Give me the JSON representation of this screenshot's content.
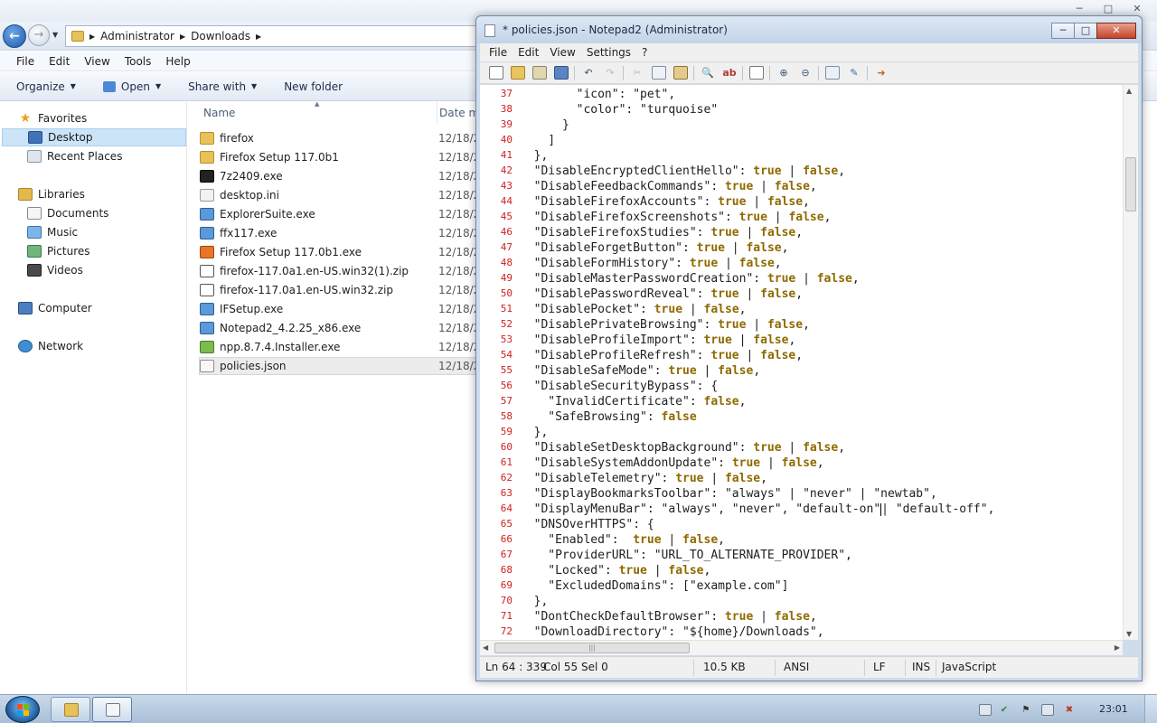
{
  "explorer": {
    "breadcrumb": [
      "Administrator",
      "Downloads"
    ],
    "menu": [
      "File",
      "Edit",
      "View",
      "Tools",
      "Help"
    ],
    "toolbar": {
      "organize": "Organize",
      "open": "Open",
      "share": "Share with",
      "new_folder": "New folder"
    },
    "nav": {
      "favorites": "Favorites",
      "desktop": "Desktop",
      "recent": "Recent Places",
      "libraries": "Libraries",
      "documents": "Documents",
      "music": "Music",
      "pictures": "Pictures",
      "videos": "Videos",
      "computer": "Computer",
      "network": "Network"
    },
    "columns": {
      "name": "Name",
      "date": "Date m"
    },
    "files": [
      {
        "name": "firefox",
        "date": "12/18/2",
        "icon": "folder-icon"
      },
      {
        "name": "Firefox Setup 117.0b1",
        "date": "12/18/2",
        "icon": "folder-icon"
      },
      {
        "name": "7z2409.exe",
        "date": "12/18/2",
        "icon": "7zip-icon"
      },
      {
        "name": "desktop.ini",
        "date": "12/18/2",
        "icon": "settings-file-icon"
      },
      {
        "name": "ExplorerSuite.exe",
        "date": "12/18/2",
        "icon": "application-icon"
      },
      {
        "name": "ffx117.exe",
        "date": "12/18/2",
        "icon": "application-icon"
      },
      {
        "name": "Firefox Setup 117.0b1.exe",
        "date": "12/18/2",
        "icon": "firefox-icon"
      },
      {
        "name": "firefox-117.0a1.en-US.win32(1).zip",
        "date": "12/18/2",
        "icon": "zip-icon"
      },
      {
        "name": "firefox-117.0a1.en-US.win32.zip",
        "date": "12/18/2",
        "icon": "zip-icon"
      },
      {
        "name": "IFSetup.exe",
        "date": "12/18/2",
        "icon": "application-icon"
      },
      {
        "name": "Notepad2_4.2.25_x86.exe",
        "date": "12/18/2",
        "icon": "notepad-icon"
      },
      {
        "name": "npp.8.7.4.Installer.exe",
        "date": "12/18/2",
        "icon": "notepadpp-icon"
      },
      {
        "name": "policies.json",
        "date": "12/18/2",
        "icon": "json-file-icon"
      }
    ]
  },
  "notepad": {
    "title": "* policies.json - Notepad2 (Administrator)",
    "menu": [
      "File",
      "Edit",
      "View",
      "Settings",
      "?"
    ],
    "lines": [
      {
        "n": "37",
        "t": "        \"icon\": \"pet\","
      },
      {
        "n": "38",
        "t": "        \"color\": \"turquoise\""
      },
      {
        "n": "39",
        "t": "      }"
      },
      {
        "n": "40",
        "t": "    ]"
      },
      {
        "n": "41",
        "t": "  },"
      },
      {
        "n": "42",
        "t": "  \"DisableEncryptedClientHello\": true | false,"
      },
      {
        "n": "43",
        "t": "  \"DisableFeedbackCommands\": true | false,"
      },
      {
        "n": "44",
        "t": "  \"DisableFirefoxAccounts\": true | false,"
      },
      {
        "n": "45",
        "t": "  \"DisableFirefoxScreenshots\": true | false,"
      },
      {
        "n": "46",
        "t": "  \"DisableFirefoxStudies\": true | false,"
      },
      {
        "n": "47",
        "t": "  \"DisableForgetButton\": true | false,"
      },
      {
        "n": "48",
        "t": "  \"DisableFormHistory\": true | false,"
      },
      {
        "n": "49",
        "t": "  \"DisableMasterPasswordCreation\": true | false,"
      },
      {
        "n": "50",
        "t": "  \"DisablePasswordReveal\": true | false,"
      },
      {
        "n": "51",
        "t": "  \"DisablePocket\": true | false,"
      },
      {
        "n": "52",
        "t": "  \"DisablePrivateBrowsing\": true | false,"
      },
      {
        "n": "53",
        "t": "  \"DisableProfileImport\": true | false,"
      },
      {
        "n": "54",
        "t": "  \"DisableProfileRefresh\": true | false,"
      },
      {
        "n": "55",
        "t": "  \"DisableSafeMode\": true | false,"
      },
      {
        "n": "56",
        "t": "  \"DisableSecurityBypass\": {"
      },
      {
        "n": "57",
        "t": "    \"InvalidCertificate\": false,"
      },
      {
        "n": "58",
        "t": "    \"SafeBrowsing\": false"
      },
      {
        "n": "59",
        "t": "  },"
      },
      {
        "n": "60",
        "t": "  \"DisableSetDesktopBackground\": true | false,"
      },
      {
        "n": "61",
        "t": "  \"DisableSystemAddonUpdate\": true | false,"
      },
      {
        "n": "62",
        "t": "  \"DisableTelemetry\": true | false,"
      },
      {
        "n": "63",
        "t": "  \"DisplayBookmarksToolbar\": \"always\" | \"never\" | \"newtab\","
      },
      {
        "n": "64",
        "t": "  \"DisplayMenuBar\": \"always\", \"never\", \"default-on\"| \"default-off\","
      },
      {
        "n": "65",
        "t": "  \"DNSOverHTTPS\": {"
      },
      {
        "n": "66",
        "t": "    \"Enabled\":  true | false,"
      },
      {
        "n": "67",
        "t": "    \"ProviderURL\": \"URL_TO_ALTERNATE_PROVIDER\","
      },
      {
        "n": "68",
        "t": "    \"Locked\": true | false,"
      },
      {
        "n": "69",
        "t": "    \"ExcludedDomains\": [\"example.com\"]"
      },
      {
        "n": "70",
        "t": "  },"
      },
      {
        "n": "71",
        "t": "  \"DontCheckDefaultBrowser\": true | false,"
      },
      {
        "n": "72",
        "t": "  \"DownloadDirectory\": \"${home}/Downloads\","
      }
    ],
    "status": {
      "position": "Ln 64 : 339",
      "col": "Col 55",
      "sel": "Sel 0",
      "size": "10.5 KB",
      "encoding": "ANSI",
      "eol": "LF",
      "mode": "INS",
      "lexer": "JavaScript"
    }
  },
  "taskbar": {
    "clock": "23:01"
  },
  "colors": {
    "keyword": "#8e6a00",
    "line_number": "#d02020",
    "selection": "#cce4f7"
  }
}
